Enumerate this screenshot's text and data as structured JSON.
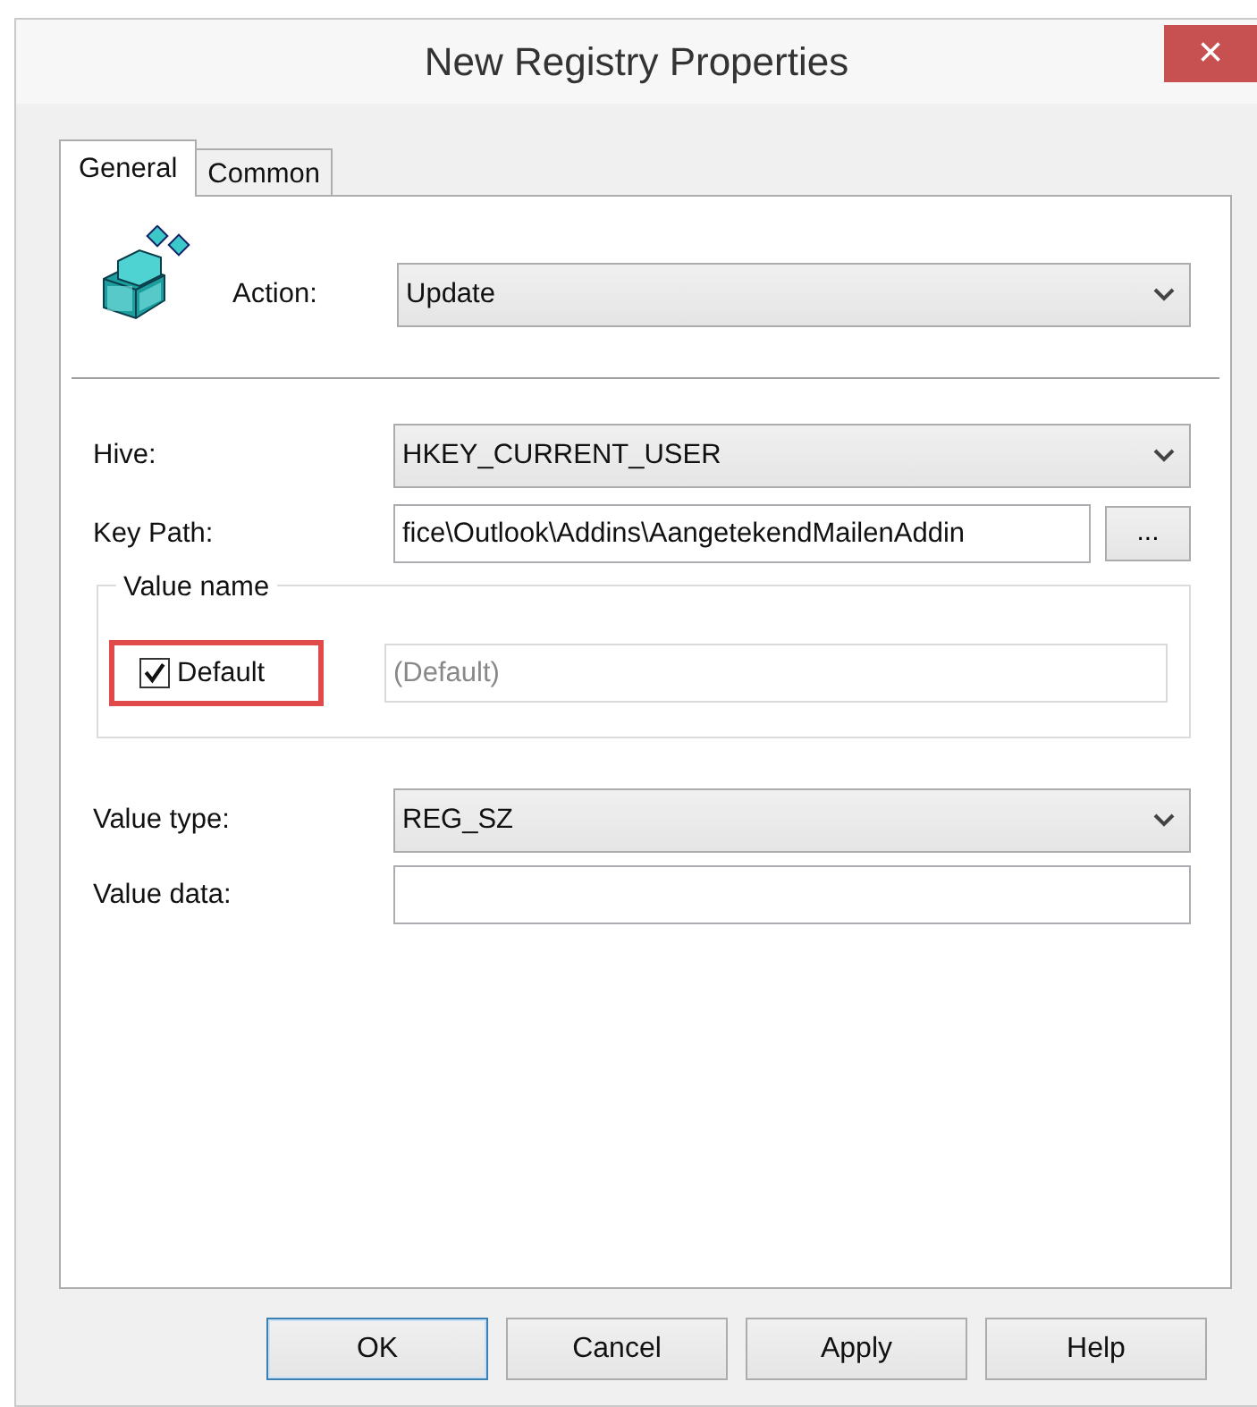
{
  "window": {
    "title": "New Registry Properties",
    "close": "×"
  },
  "tabs": [
    {
      "label": "General",
      "selected": true
    },
    {
      "label": "Common",
      "selected": false
    }
  ],
  "action": {
    "label": "Action:",
    "value": "Update"
  },
  "fields": [
    {
      "kind": "select",
      "label": "Hive:",
      "value": "HKEY_CURRENT_USER"
    },
    {
      "kind": "path",
      "label": "Key Path:",
      "value": "fice\\Outlook\\Addins\\AangetekendMailenAddin",
      "button": "..."
    }
  ],
  "value_name": {
    "legend": "Value name",
    "checkbox": {
      "label": "Default",
      "checked": true,
      "highlighted": true
    },
    "field": {
      "value": "(Default)",
      "disabled": true
    }
  },
  "value_fields": [
    {
      "kind": "select",
      "label": "Value type:",
      "value": "REG_SZ"
    },
    {
      "kind": "text",
      "label": "Value data:"
    }
  ],
  "buttons": [
    {
      "label": "OK",
      "default": true
    },
    {
      "label": "Cancel",
      "default": false
    },
    {
      "label": "Apply",
      "default": false
    },
    {
      "label": "Help",
      "default": false
    }
  ]
}
